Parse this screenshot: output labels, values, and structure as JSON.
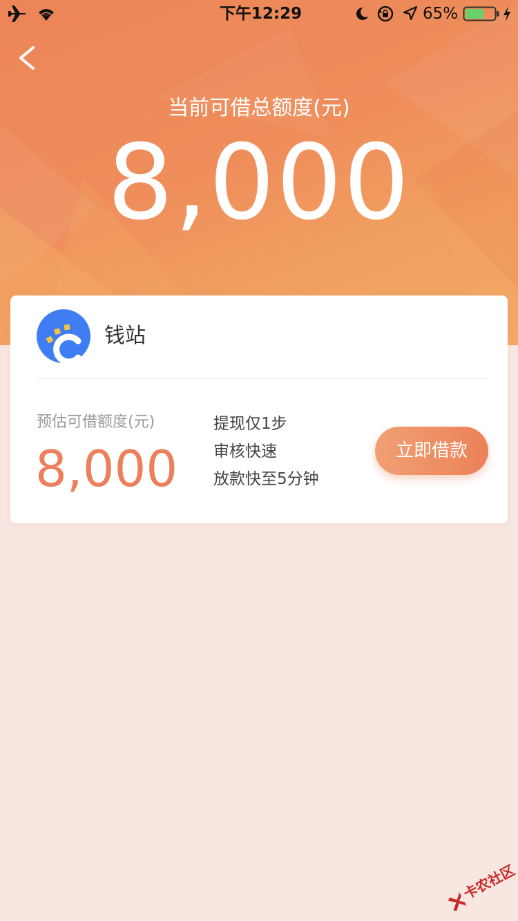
{
  "status_bar": {
    "time": "下午12:29",
    "battery_percent": "65%",
    "battery_level": 0.65
  },
  "header": {
    "back_icon": "chevron-left-icon",
    "total_label": "当前可借总额度(元)",
    "total_amount": "8,000"
  },
  "product": {
    "name": "钱站",
    "limit_label": "预估可借额度(元)",
    "limit_value": "8,000",
    "features": [
      "提现仅1步",
      "审核快速",
      "放款快至5分钟"
    ],
    "cta_label": "立即借款"
  },
  "watermark": {
    "text": "卡农社区"
  },
  "colors": {
    "accent": "#ec7f5c",
    "hero_gradient_start": "#ec8558",
    "hero_gradient_end": "#f3a866",
    "page_background": "#f8e6e1",
    "logo_blue": "#3f7df2",
    "logo_yellow": "#f6c443"
  }
}
